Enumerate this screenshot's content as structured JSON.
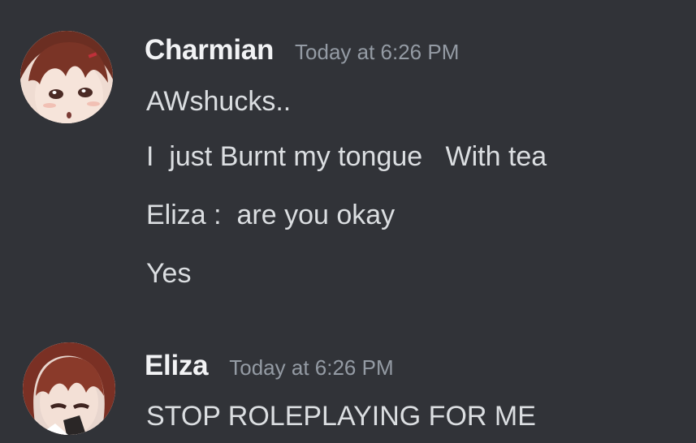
{
  "colors": {
    "background": "#313338",
    "username": "#f2f3f5",
    "timestamp": "#949ba4",
    "message_text": "#dbdee1"
  },
  "messages": [
    {
      "author": "Charmian",
      "timestamp": "Today at 6:26 PM",
      "avatar_icon": "avatar-charmian-icon",
      "lines": [
        "AWshucks..",
        "I  just Burnt my tongue   With tea",
        "Eliza :  are you okay",
        "Yes"
      ]
    },
    {
      "author": "Eliza",
      "timestamp": "Today at 6:26 PM",
      "avatar_icon": "avatar-eliza-icon",
      "lines": [
        "STOP ROLEPLAYING FOR ME"
      ]
    }
  ]
}
